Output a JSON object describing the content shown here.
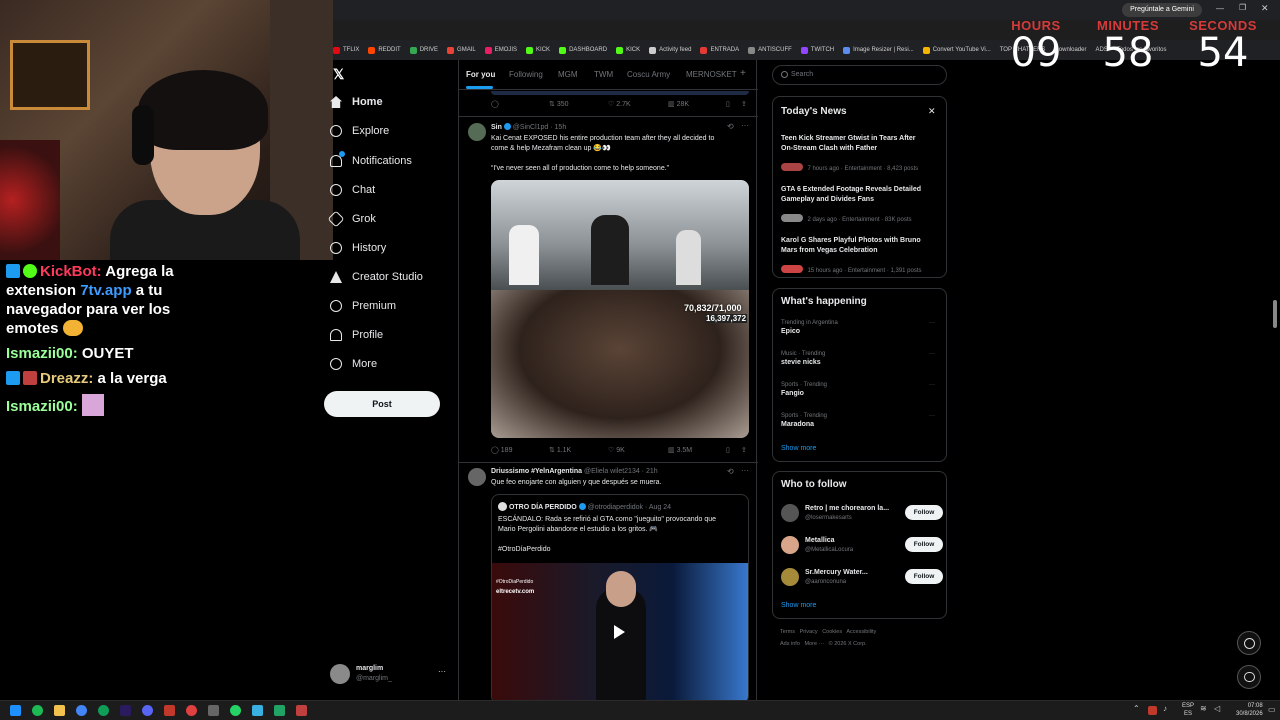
{
  "chat": {
    "msg1": {
      "user": "KickBot:",
      "text1": "Agrega la",
      "text2": "extension",
      "link": "7tv.app",
      "text3": "a tu",
      "text4": "navegador para ver los",
      "text5": "emotes"
    },
    "msg2": {
      "user": "Ismazii00:",
      "text": "OUYET"
    },
    "msg3": {
      "user": "Dreazz:",
      "text": "a la verga"
    },
    "msg4": {
      "user": "Ismazii00:"
    }
  },
  "browser": {
    "gemini_label": "Pregúntale a Gemini",
    "bookmarks": [
      "TFLIX",
      "REDDIT",
      "DRIVE",
      "GMAIL",
      "EMOJIS",
      "KICK",
      "DASHBOARD",
      "KICK",
      "Activity feed",
      "ENTRADA",
      "ANTISCUFF",
      "TWITCH",
      "Image Resizer | Resi...",
      "Convert YouTube Vi...",
      "TOP CHATTERS",
      "Downloader",
      "ADS",
      "Todos los favoritos"
    ]
  },
  "timer": {
    "hours_label": "HOURS",
    "minutes_label": "MINUTES",
    "seconds_label": "SECONDS",
    "hours": "09",
    "minutes": "58",
    "seconds": "54"
  },
  "nav": {
    "items": [
      "Home",
      "Explore",
      "Notifications",
      "Chat",
      "Grok",
      "History",
      "Creator Studio",
      "Premium",
      "Profile",
      "More"
    ],
    "post": "Post",
    "account_name": "marglim",
    "account_handle": "@marglim_"
  },
  "feed": {
    "tabs": [
      "For you",
      "Following",
      "MGM",
      "TWM",
      "Coscu Army",
      "MERNOSKET"
    ],
    "top_actions": {
      "retweets": "350",
      "likes": "2.7K",
      "views": "28K"
    },
    "tweet1": {
      "name": "Sin",
      "handle": "@SinCl1pd · 15h",
      "text1": "Kai Cenat EXPOSED his entire production team after they all decided to",
      "text2": "come & help Mezafram clean up 😂👀",
      "text3": "“I've never seen all of production come to help someone.”",
      "overlay1": "70,832/71,000",
      "overlay2": "16,397,372",
      "replies": "189",
      "retweets": "1.1K",
      "likes": "9K",
      "views": "3.5M"
    },
    "tweet2": {
      "name": "Driussismo #YelnArgentina",
      "handle": "@Eliela wilet2134 · 21h",
      "text": "Que feo enojarte con alguien y que después se muera.",
      "quote_name": "OTRO DÍA PERDIDO",
      "quote_handle": "@otrodiaperdidok · Aug 24",
      "quote_text1": "ESCÁNDALO: Rada se refirió al GTA como \"jueguito\" provocando que",
      "quote_text2": "Mario Pergolini abandone el estudio a los gritos. 🎮",
      "quote_tag": "#OtroDíaPerdido",
      "video_overlay": "eltrecetv.com",
      "video_tag": "#OtroDiaPerdido"
    }
  },
  "right": {
    "search_placeholder": "Search",
    "news_title": "Today's News",
    "news": [
      {
        "title1": "Teen Kick Streamer Gtwist in Tears After",
        "title2": "On-Stream Clash with Father",
        "meta": "7 hours ago · Entertainment · 8,423 posts"
      },
      {
        "title1": "GTA 6 Extended Footage Reveals Detailed",
        "title2": "Gameplay and Divides Fans",
        "meta": "2 days ago · Entertainment · 83K posts"
      },
      {
        "title1": "Karol G Shares Playful Photos with Bruno",
        "title2": "Mars from Vegas Celebration",
        "meta": "15 hours ago · Entertainment · 1,391 posts"
      }
    ],
    "happening_title": "What's happening",
    "trends": [
      {
        "context": "Trending in Argentina",
        "name": "Epico"
      },
      {
        "context": "Music · Trending",
        "name": "stevie nicks"
      },
      {
        "context": "Sports · Trending",
        "name": "Fangio"
      },
      {
        "context": "Sports · Trending",
        "name": "Maradona"
      }
    ],
    "show_more": "Show more",
    "follow_title": "Who to follow",
    "follow": [
      {
        "name": "Retro | me chorearon la...",
        "handle": "@losermakesarts",
        "btn": "Follow"
      },
      {
        "name": "Metallica",
        "handle": "@MetallicaLocura",
        "btn": "Follow"
      },
      {
        "name": "Sr.Mercury Water...",
        "handle": "@aaronconuna",
        "btn": "Follow"
      }
    ],
    "footer1": [
      "Terms",
      "Privacy",
      "Cookies",
      "Accessibility"
    ],
    "footer2": [
      "Ads info",
      "More ···",
      "© 2026 X Corp."
    ]
  },
  "taskbar": {
    "lang1": "ESP",
    "lang2": "ES",
    "time": "07:08",
    "date": "30/8/2026"
  },
  "colors": {
    "accent": "#1d9bf0",
    "timer_label": "#d63a3a",
    "bg": "#000000"
  }
}
